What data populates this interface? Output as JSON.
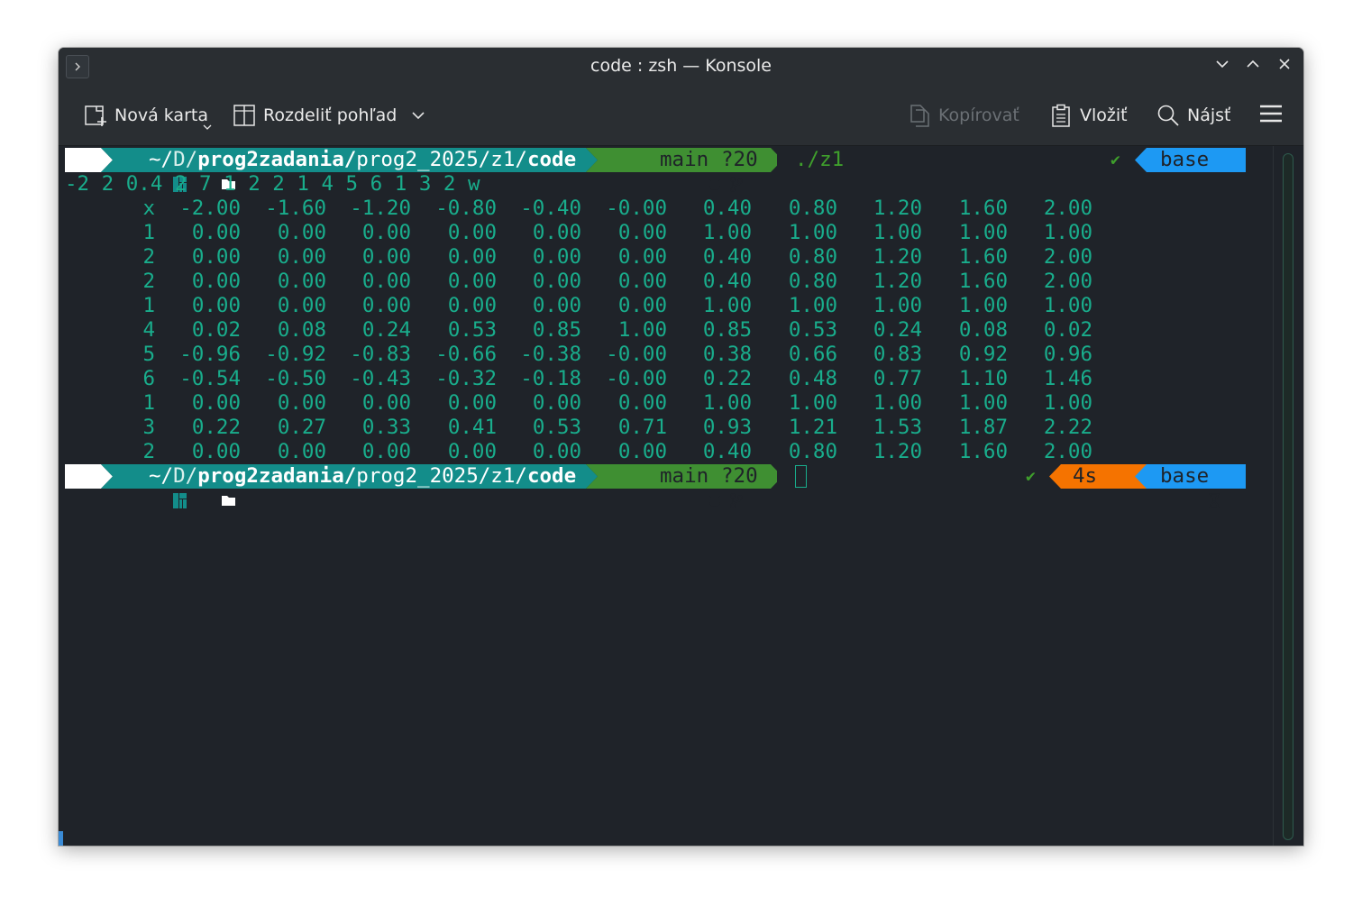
{
  "window": {
    "title": "code : zsh — Konsole"
  },
  "toolbar": {
    "new_tab": "Nová karta",
    "split_view": "Rozdeliť pohľad",
    "copy": "Kopírovať",
    "paste": "Vložiť",
    "find": "Nájsť"
  },
  "prompt": {
    "path_tilde": "~/",
    "path_d": "D/",
    "path_prog2zadania": "prog2zadania/",
    "path_rest": "prog2_2025/z1/",
    "path_code": "code",
    "git_branch": "main",
    "git_status": "?20",
    "command": "./z1",
    "ok_mark": "✔",
    "conda_env": "base",
    "duration": "4s"
  },
  "output": {
    "input_line": "-2 2 0.4 2 7 1 2 2 1 4 5 6 1 3 2 w",
    "rows": [
      {
        "label": "x",
        "values": [
          "-2.00",
          "-1.60",
          "-1.20",
          "-0.80",
          "-0.40",
          "-0.00",
          "0.40",
          "0.80",
          "1.20",
          "1.60",
          "2.00"
        ]
      },
      {
        "label": "1",
        "values": [
          "0.00",
          "0.00",
          "0.00",
          "0.00",
          "0.00",
          "0.00",
          "1.00",
          "1.00",
          "1.00",
          "1.00",
          "1.00"
        ]
      },
      {
        "label": "2",
        "values": [
          "0.00",
          "0.00",
          "0.00",
          "0.00",
          "0.00",
          "0.00",
          "0.40",
          "0.80",
          "1.20",
          "1.60",
          "2.00"
        ]
      },
      {
        "label": "2",
        "values": [
          "0.00",
          "0.00",
          "0.00",
          "0.00",
          "0.00",
          "0.00",
          "0.40",
          "0.80",
          "1.20",
          "1.60",
          "2.00"
        ]
      },
      {
        "label": "1",
        "values": [
          "0.00",
          "0.00",
          "0.00",
          "0.00",
          "0.00",
          "0.00",
          "1.00",
          "1.00",
          "1.00",
          "1.00",
          "1.00"
        ]
      },
      {
        "label": "4",
        "values": [
          "0.02",
          "0.08",
          "0.24",
          "0.53",
          "0.85",
          "1.00",
          "0.85",
          "0.53",
          "0.24",
          "0.08",
          "0.02"
        ]
      },
      {
        "label": "5",
        "values": [
          "-0.96",
          "-0.92",
          "-0.83",
          "-0.66",
          "-0.38",
          "-0.00",
          "0.38",
          "0.66",
          "0.83",
          "0.92",
          "0.96"
        ]
      },
      {
        "label": "6",
        "values": [
          "-0.54",
          "-0.50",
          "-0.43",
          "-0.32",
          "-0.18",
          "-0.00",
          "0.22",
          "0.48",
          "0.77",
          "1.10",
          "1.46"
        ]
      },
      {
        "label": "1",
        "values": [
          "0.00",
          "0.00",
          "0.00",
          "0.00",
          "0.00",
          "0.00",
          "1.00",
          "1.00",
          "1.00",
          "1.00",
          "1.00"
        ]
      },
      {
        "label": "3",
        "values": [
          "0.22",
          "0.27",
          "0.33",
          "0.41",
          "0.53",
          "0.71",
          "0.93",
          "1.21",
          "1.53",
          "1.87",
          "2.22"
        ]
      },
      {
        "label": "2",
        "values": [
          "0.00",
          "0.00",
          "0.00",
          "0.00",
          "0.00",
          "0.00",
          "0.40",
          "0.80",
          "1.20",
          "1.60",
          "2.00"
        ]
      }
    ]
  },
  "colors": {
    "terminal_bg": "#1f2329",
    "terminal_text": "#19ad8c",
    "os_segment": "#ffffff",
    "path_segment": "#138d8a",
    "git_segment": "#3f8f32",
    "status_ok": "#3f9f2c",
    "duration_segment": "#f57300",
    "conda_segment": "#1d99f3"
  }
}
